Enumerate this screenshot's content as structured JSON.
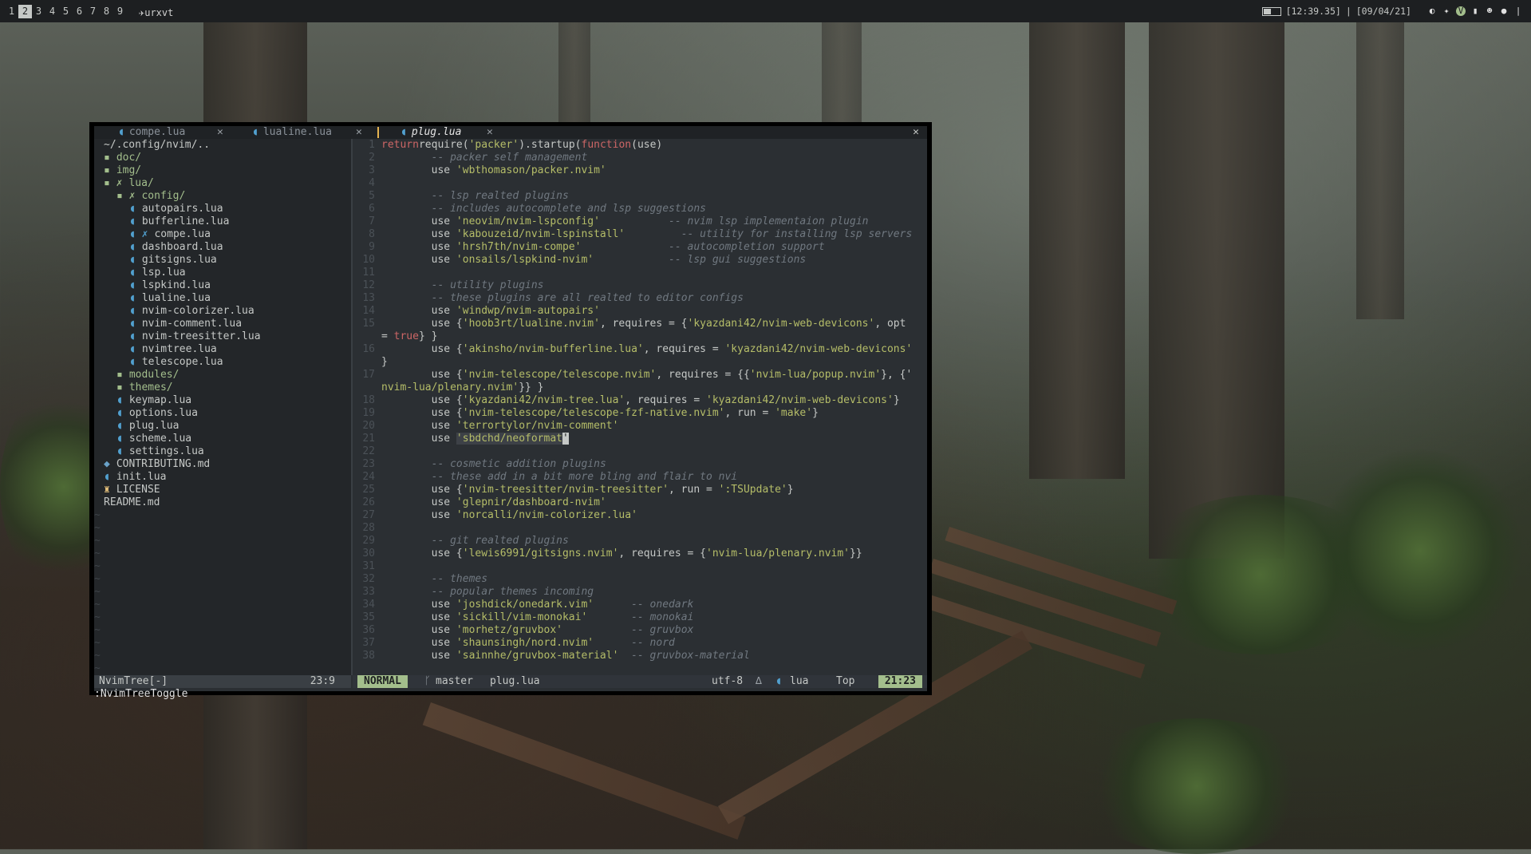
{
  "topbar": {
    "workspaces": [
      "1",
      "2",
      "3",
      "4",
      "5",
      "6",
      "7",
      "8",
      "9"
    ],
    "active_workspace": "2",
    "window_title": "✈urxvt",
    "time": "[12:39.35]",
    "separator": "|",
    "date": "[09/04/21]",
    "tray_icons": [
      "moon-icon",
      "wrench-icon",
      "vpn-icon",
      "phone-icon",
      "discord-icon",
      "github-icon",
      "power-icon"
    ]
  },
  "tabs": [
    {
      "icon": "lua-icon",
      "label": "compe.lua",
      "close": "✕"
    },
    {
      "icon": "lua-icon",
      "label": "lualine.lua",
      "close": "✕"
    },
    {
      "icon": "lua-icon",
      "label": "plug.lua",
      "close": "✕",
      "active": true
    }
  ],
  "tabline_close": "✕",
  "tree": {
    "root": "~/.config/nvim/..",
    "items": [
      {
        "indent": 0,
        "icon": "▪",
        "label": "doc/",
        "type": "dir"
      },
      {
        "indent": 0,
        "icon": "▪",
        "label": "img/",
        "type": "dir"
      },
      {
        "indent": 0,
        "icon": "▪ ✗",
        "label": "lua/",
        "type": "dir"
      },
      {
        "indent": 1,
        "icon": "▪ ✗",
        "label": "config/",
        "type": "dir"
      },
      {
        "indent": 2,
        "icon": "◖",
        "label": "autopairs.lua",
        "type": "lua"
      },
      {
        "indent": 2,
        "icon": "◖",
        "label": "bufferline.lua",
        "type": "lua"
      },
      {
        "indent": 2,
        "icon": "◖ ✗",
        "label": "compe.lua",
        "type": "lua"
      },
      {
        "indent": 2,
        "icon": "◖",
        "label": "dashboard.lua",
        "type": "lua"
      },
      {
        "indent": 2,
        "icon": "◖",
        "label": "gitsigns.lua",
        "type": "lua"
      },
      {
        "indent": 2,
        "icon": "◖",
        "label": "lsp.lua",
        "type": "lua"
      },
      {
        "indent": 2,
        "icon": "◖",
        "label": "lspkind.lua",
        "type": "lua"
      },
      {
        "indent": 2,
        "icon": "◖",
        "label": "lualine.lua",
        "type": "lua"
      },
      {
        "indent": 2,
        "icon": "◖",
        "label": "nvim-colorizer.lua",
        "type": "lua"
      },
      {
        "indent": 2,
        "icon": "◖",
        "label": "nvim-comment.lua",
        "type": "lua"
      },
      {
        "indent": 2,
        "icon": "◖",
        "label": "nvim-treesitter.lua",
        "type": "lua"
      },
      {
        "indent": 2,
        "icon": "◖",
        "label": "nvimtree.lua",
        "type": "lua"
      },
      {
        "indent": 2,
        "icon": "◖",
        "label": "telescope.lua",
        "type": "lua"
      },
      {
        "indent": 1,
        "icon": "▪",
        "label": "modules/",
        "type": "dir"
      },
      {
        "indent": 1,
        "icon": "▪",
        "label": "themes/",
        "type": "dir"
      },
      {
        "indent": 1,
        "icon": "◖",
        "label": "keymap.lua",
        "type": "lua"
      },
      {
        "indent": 1,
        "icon": "◖",
        "label": "options.lua",
        "type": "lua"
      },
      {
        "indent": 1,
        "icon": "◖",
        "label": "plug.lua",
        "type": "lua"
      },
      {
        "indent": 1,
        "icon": "◖",
        "label": "scheme.lua",
        "type": "lua"
      },
      {
        "indent": 1,
        "icon": "◖",
        "label": "settings.lua",
        "type": "lua"
      },
      {
        "indent": 0,
        "icon": "◆",
        "label": "CONTRIBUTING.md",
        "type": "md"
      },
      {
        "indent": 0,
        "icon": "◖",
        "label": "init.lua",
        "type": "lua"
      },
      {
        "indent": 0,
        "icon": "♜",
        "label": "LICENSE",
        "type": "lic"
      },
      {
        "indent": 0,
        "icon": "",
        "label": "README.md",
        "type": "plain"
      }
    ],
    "filler_rows": 13,
    "filler_char": "~"
  },
  "code": {
    "lines": [
      {
        "n": "1",
        "seg": [
          [
            "kw",
            "return"
          ],
          [
            "",
            "require("
          ],
          [
            "str",
            "'packer'"
          ],
          [
            "",
            ").startup("
          ],
          [
            "kw",
            "function"
          ],
          [
            "",
            "(use)"
          ]
        ]
      },
      {
        "n": "2",
        "seg": [
          [
            "",
            "        "
          ],
          [
            "cm",
            "-- packer self management"
          ]
        ]
      },
      {
        "n": "3",
        "seg": [
          [
            "",
            "        use "
          ],
          [
            "str",
            "'wbthomason/packer.nvim'"
          ]
        ]
      },
      {
        "n": "4",
        "seg": []
      },
      {
        "n": "5",
        "seg": [
          [
            "",
            "        "
          ],
          [
            "cm",
            "-- lsp realted plugins"
          ]
        ]
      },
      {
        "n": "6",
        "seg": [
          [
            "",
            "        "
          ],
          [
            "cm",
            "-- includes autocomplete and lsp suggestions"
          ]
        ]
      },
      {
        "n": "7",
        "seg": [
          [
            "",
            "        use "
          ],
          [
            "str",
            "'neovim/nvim-lspconfig'"
          ],
          [
            "",
            "           "
          ],
          [
            "cm",
            "-- nvim lsp implementaion plugin"
          ]
        ]
      },
      {
        "n": "8",
        "seg": [
          [
            "",
            "        use "
          ],
          [
            "str",
            "'kabouzeid/nvim-lspinstall'"
          ],
          [
            "",
            "         "
          ],
          [
            "cm",
            "-- utility for installing lsp servers"
          ]
        ]
      },
      {
        "n": "9",
        "seg": [
          [
            "",
            "        use "
          ],
          [
            "str",
            "'hrsh7th/nvim-compe'"
          ],
          [
            "",
            "              "
          ],
          [
            "cm",
            "-- autocompletion support"
          ]
        ]
      },
      {
        "n": "10",
        "seg": [
          [
            "",
            "        use "
          ],
          [
            "str",
            "'onsails/lspkind-nvim'"
          ],
          [
            "",
            "            "
          ],
          [
            "cm",
            "-- lsp gui suggestions"
          ]
        ]
      },
      {
        "n": "11",
        "seg": []
      },
      {
        "n": "12",
        "seg": [
          [
            "",
            "        "
          ],
          [
            "cm",
            "-- utility plugins"
          ]
        ]
      },
      {
        "n": "13",
        "seg": [
          [
            "",
            "        "
          ],
          [
            "cm",
            "-- these plugins are all realted to editor configs"
          ]
        ]
      },
      {
        "n": "14",
        "seg": [
          [
            "",
            "        use "
          ],
          [
            "str",
            "'windwp/nvim-autopairs'"
          ]
        ]
      },
      {
        "n": "15",
        "seg": [
          [
            "",
            "        use {"
          ],
          [
            "str",
            "'hoob3rt/lualine.nvim'"
          ],
          [
            "",
            ", requires = {"
          ],
          [
            "str",
            "'kyazdani42/nvim-web-devicons'"
          ],
          [
            "",
            ", opt"
          ]
        ]
      },
      {
        "n": "",
        "seg": [
          [
            "",
            "= "
          ],
          [
            "kw",
            "true"
          ],
          [
            "",
            "} }"
          ]
        ]
      },
      {
        "n": "16",
        "seg": [
          [
            "",
            "        use {"
          ],
          [
            "str",
            "'akinsho/nvim-bufferline.lua'"
          ],
          [
            "",
            ", requires = "
          ],
          [
            "str",
            "'kyazdani42/nvim-web-devicons'"
          ]
        ]
      },
      {
        "n": "",
        "seg": [
          [
            "",
            "}"
          ]
        ]
      },
      {
        "n": "17",
        "seg": [
          [
            "",
            "        use {"
          ],
          [
            "str",
            "'nvim-telescope/telescope.nvim'"
          ],
          [
            "",
            ", requires = {{"
          ],
          [
            "str",
            "'nvim-lua/popup.nvim'"
          ],
          [
            "",
            "}, {'"
          ]
        ]
      },
      {
        "n": "",
        "seg": [
          [
            "str",
            "nvim-lua/plenary.nvim'"
          ],
          [
            "",
            "}} }"
          ]
        ]
      },
      {
        "n": "18",
        "seg": [
          [
            "",
            "        use {"
          ],
          [
            "str",
            "'kyazdani42/nvim-tree.lua'"
          ],
          [
            "",
            ", requires = "
          ],
          [
            "str",
            "'kyazdani42/nvim-web-devicons'"
          ],
          [
            "",
            "}"
          ]
        ]
      },
      {
        "n": "19",
        "seg": [
          [
            "",
            "        use {"
          ],
          [
            "str",
            "'nvim-telescope/telescope-fzf-native.nvim'"
          ],
          [
            "",
            ", run = "
          ],
          [
            "str",
            "'make'"
          ],
          [
            "",
            "}"
          ]
        ]
      },
      {
        "n": "20",
        "seg": [
          [
            "",
            "        use "
          ],
          [
            "str",
            "'terrortylor/nvim-comment'"
          ]
        ]
      },
      {
        "n": "21",
        "seg": [
          [
            "",
            "        use "
          ],
          [
            "strhl",
            "'sbdchd/neoformat"
          ],
          [
            "cursor",
            "'"
          ]
        ]
      },
      {
        "n": "22",
        "seg": []
      },
      {
        "n": "23",
        "seg": [
          [
            "",
            "        "
          ],
          [
            "cm",
            "-- cosmetic addition plugins"
          ]
        ]
      },
      {
        "n": "24",
        "seg": [
          [
            "",
            "        "
          ],
          [
            "cm",
            "-- these add in a bit more bling and flair to nvi"
          ]
        ]
      },
      {
        "n": "25",
        "seg": [
          [
            "",
            "        use {"
          ],
          [
            "str",
            "'nvim-treesitter/nvim-treesitter'"
          ],
          [
            "",
            ", run = "
          ],
          [
            "str",
            "':TSUpdate'"
          ],
          [
            "",
            "}"
          ]
        ]
      },
      {
        "n": "26",
        "seg": [
          [
            "",
            "        use "
          ],
          [
            "str",
            "'glepnir/dashboard-nvim'"
          ]
        ]
      },
      {
        "n": "27",
        "seg": [
          [
            "",
            "        use "
          ],
          [
            "str",
            "'norcalli/nvim-colorizer.lua'"
          ]
        ]
      },
      {
        "n": "28",
        "seg": []
      },
      {
        "n": "29",
        "seg": [
          [
            "",
            "        "
          ],
          [
            "cm",
            "-- git realted plugins"
          ]
        ]
      },
      {
        "n": "30",
        "seg": [
          [
            "",
            "        use {"
          ],
          [
            "str",
            "'lewis6991/gitsigns.nvim'"
          ],
          [
            "",
            ", requires = {"
          ],
          [
            "str",
            "'nvim-lua/plenary.nvim'"
          ],
          [
            "",
            "}}"
          ]
        ]
      },
      {
        "n": "31",
        "seg": []
      },
      {
        "n": "32",
        "seg": [
          [
            "",
            "        "
          ],
          [
            "cm",
            "-- themes"
          ]
        ]
      },
      {
        "n": "33",
        "seg": [
          [
            "",
            "        "
          ],
          [
            "cm",
            "-- popular themes incoming"
          ]
        ]
      },
      {
        "n": "34",
        "seg": [
          [
            "",
            "        use "
          ],
          [
            "str",
            "'joshdick/onedark.vim'"
          ],
          [
            "",
            "      "
          ],
          [
            "cm",
            "-- onedark"
          ]
        ]
      },
      {
        "n": "35",
        "seg": [
          [
            "",
            "        use "
          ],
          [
            "str",
            "'sickill/vim-monokai'"
          ],
          [
            "",
            "       "
          ],
          [
            "cm",
            "-- monokai"
          ]
        ]
      },
      {
        "n": "36",
        "seg": [
          [
            "",
            "        use "
          ],
          [
            "str",
            "'morhetz/gruvbox'"
          ],
          [
            "",
            "           "
          ],
          [
            "cm",
            "-- gruvbox"
          ]
        ]
      },
      {
        "n": "37",
        "seg": [
          [
            "",
            "        use "
          ],
          [
            "str",
            "'shaunsingh/nord.nvim'"
          ],
          [
            "",
            "      "
          ],
          [
            "cm",
            "-- nord"
          ]
        ]
      },
      {
        "n": "38",
        "seg": [
          [
            "",
            "        use "
          ],
          [
            "str",
            "'sainnhe/gruvbox-material'"
          ],
          [
            "",
            "  "
          ],
          [
            "cm",
            "-- gruvbox-material"
          ]
        ]
      }
    ]
  },
  "status": {
    "tree_label": "NvimTree[-]",
    "tree_pos": "23:9",
    "mode": "NORMAL",
    "branch_icon": "ᚴ",
    "branch": "master",
    "file": "plug.lua",
    "encoding": "utf-8",
    "format_icon": "∆",
    "ft_icon": "◖",
    "filetype": "lua",
    "scroll": "Top",
    "position": "21:23"
  },
  "cmdline": ":NvimTreeToggle",
  "colors": {
    "accent": "#a3be8c",
    "string": "#b5bd68",
    "keyword": "#cc6666",
    "comment": "#707880",
    "lua_icon": "#51a0cf"
  }
}
